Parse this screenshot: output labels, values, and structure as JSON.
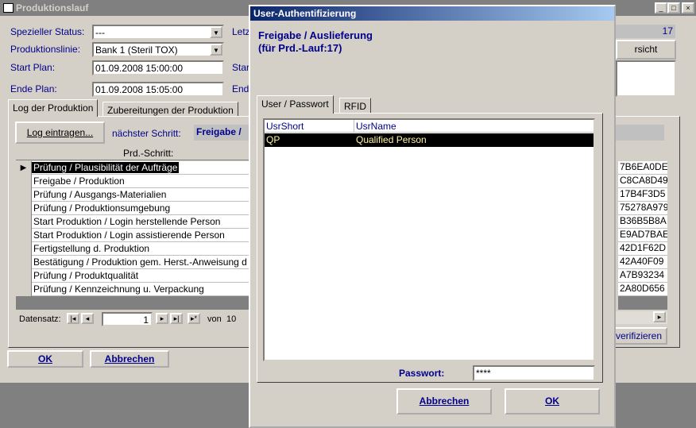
{
  "main_window": {
    "title": "Produktionslauf",
    "controls": {
      "minimize": "_",
      "maximize": "□",
      "close": "×"
    },
    "fields": {
      "status_label": "Spezieller Status:",
      "status_value": "---",
      "line_label": "Produktionslinie:",
      "line_value": "Bank 1 (Steril TOX)",
      "start_label": "Start Plan:",
      "start_value": "01.09.2008 15:00:00",
      "end_label": "Ende Plan:",
      "end_value": "01.09.2008 15:05:00",
      "letz_label": "Letz",
      "star_label": "Star",
      "ende_label": "End"
    },
    "right_number": "17",
    "right_button_label": "rsicht",
    "tabs": [
      "Log der Produktion",
      "Zubereitungen der Produktion"
    ],
    "log_button": "Log eintragen...",
    "next_step_label": "nächster Schritt:",
    "next_step_value": "Freigabe /",
    "grid_header": "Prd.-Schritt:",
    "grid_rows": [
      "Prüfung / Plausibilität der Aufträge",
      "Freigabe / Produktion",
      "Prüfung / Ausgangs-Materialien",
      "Prüfung / Produktionsumgebung",
      "Start Produktion / Login herstellende Person",
      "Start Produktion / Login assistierende Person",
      "Fertigstellung d. Produktion",
      "Bestätigung / Produktion gem. Herst.-Anweisung d",
      "Prüfung / Produktqualität",
      "Prüfung / Kennzeichnung u. Verpackung"
    ],
    "hex_values": [
      "7B6EA0DE",
      "C8CA8D49",
      "17B4F3D5",
      "75278A979",
      "B36B5B8A",
      "E9AD7BAE",
      "42D1F62D",
      "42A40F09",
      "A7B93234",
      "2A80D656"
    ],
    "nav": {
      "label": "Datensatz:",
      "value": "1",
      "of_label": "von",
      "total": "10"
    },
    "verify_button": "verifizieren",
    "ok_button": "OK",
    "cancel_button": "Abbrechen"
  },
  "dialog": {
    "title": "User-Authentifizierung",
    "heading_line1": "Freigabe / Auslieferung",
    "heading_line2": "(für Prd.-Lauf:17)",
    "tabs": [
      "User / Passwort",
      "RFID"
    ],
    "columns": [
      "UsrShort",
      "UsrName"
    ],
    "rows": [
      {
        "short": "QP",
        "name": "Qualified Person"
      }
    ],
    "password_label": "Passwort:",
    "password_value": "****",
    "cancel_button": "Abbrechen",
    "ok_button": "OK"
  }
}
